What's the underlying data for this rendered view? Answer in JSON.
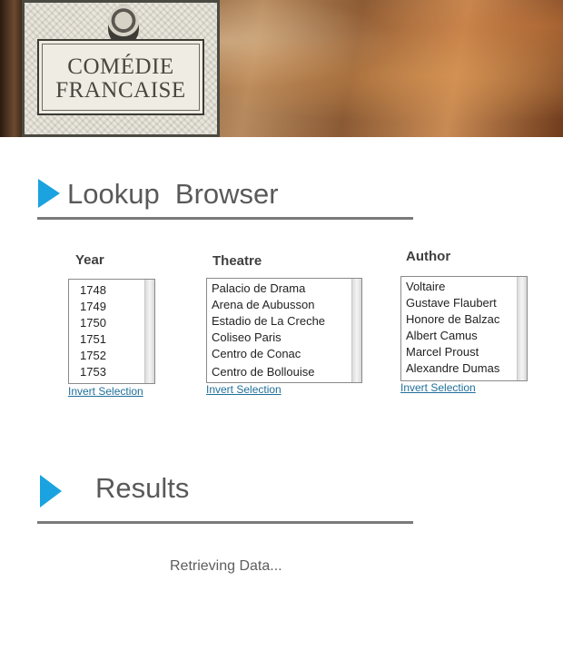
{
  "header": {
    "logo_line1": "COMÉDIE",
    "logo_line2": "FRANCAISE"
  },
  "lookup": {
    "title": "Lookup  Browser"
  },
  "filters": {
    "year": {
      "label": "Year",
      "items": [
        "1748",
        "1749",
        "1750",
        "1751",
        "1752",
        "1753"
      ],
      "invert_label": "Invert Selection"
    },
    "theatre": {
      "label": "Theatre",
      "items": [
        "Palacio de Drama",
        "Arena de Aubusson",
        "Estadio de La Creche",
        "Coliseo Paris",
        "Centro de Conac",
        " Centro de Bollouise"
      ],
      "invert_label": "Invert Selection"
    },
    "author": {
      "label": "Author",
      "items": [
        "Voltaire",
        "Gustave Flaubert",
        "Honore de Balzac",
        "Albert Camus",
        "Marcel Proust",
        "Alexandre Dumas"
      ],
      "invert_label": "Invert Selection"
    }
  },
  "results": {
    "title": "Results",
    "status": "Retrieving Data..."
  },
  "colors": {
    "accent": "#1aa3e0",
    "rule": "#7a7a7a",
    "link": "#1f6f9a"
  }
}
